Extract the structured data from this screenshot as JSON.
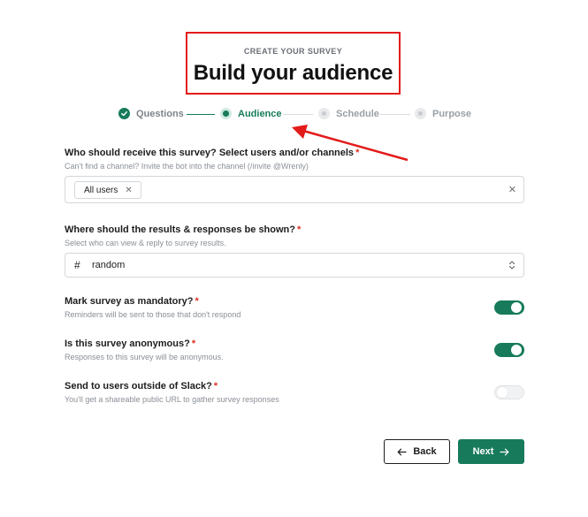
{
  "header": {
    "eyebrow": "CREATE YOUR SURVEY",
    "title": "Build your audience"
  },
  "stepper": {
    "steps": [
      {
        "label": "Questions",
        "state": "completed"
      },
      {
        "label": "Audience",
        "state": "current"
      },
      {
        "label": "Schedule",
        "state": "upcoming"
      },
      {
        "label": "Purpose",
        "state": "upcoming"
      }
    ]
  },
  "recipients": {
    "label": "Who should receive this survey? Select users and/or channels",
    "required_mark": "*",
    "help": "Can't find a channel? Invite the bot into the channel (/invite @Wrenly)",
    "chips": [
      {
        "label": "All users",
        "remove_icon": "close-icon"
      }
    ],
    "clear_icon": "close-icon"
  },
  "results_channel": {
    "label": "Where should the results & responses be shown?",
    "required_mark": "*",
    "help": "Select who can view & reply to survey results.",
    "prefix": "#",
    "value": "random",
    "icon": "chevron-updown-icon"
  },
  "toggles": [
    {
      "label": "Mark survey as mandatory?",
      "required_mark": "*",
      "help": "Reminders will be sent to those that don't respond",
      "enabled": true
    },
    {
      "label": "Is this survey anonymous?",
      "required_mark": "*",
      "help": "Responses to this survey will be anonymous.",
      "enabled": true
    },
    {
      "label": "Send to users outside of Slack?",
      "required_mark": "*",
      "help": "You'll get a shareable public URL to gather survey responses",
      "enabled": false
    }
  ],
  "actions": {
    "back_label": "Back",
    "next_label": "Next"
  },
  "colors": {
    "accent": "#177a5b",
    "annotation": "#e31b1b",
    "required": "#d93025"
  }
}
